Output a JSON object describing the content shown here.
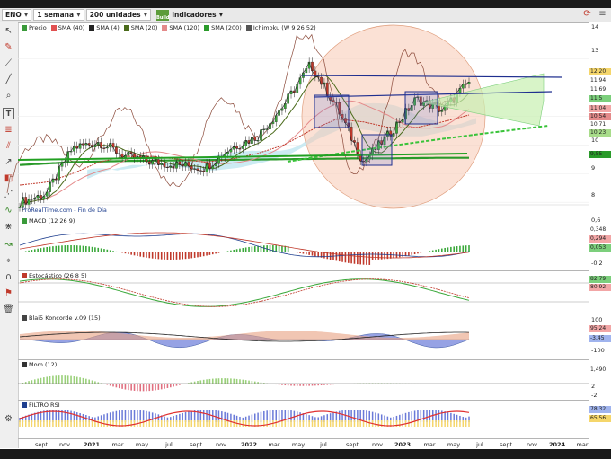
{
  "toolbar": {
    "ticker": "ENO",
    "period": "1 semana",
    "units": "200 unidades",
    "indicators": "Indicadores",
    "ind_icon_text": "Build"
  },
  "main_pane": {
    "legend": [
      {
        "label": "Precio",
        "color": "#3a9a3a"
      },
      {
        "label": "SMA (40)",
        "color": "#e05050"
      },
      {
        "label": "SMA (4)",
        "color": "#222222"
      },
      {
        "label": "SMA (20)",
        "color": "#4a6a1a"
      },
      {
        "label": "SMA (120)",
        "color": "#e48a8a"
      },
      {
        "label": "SMA (200)",
        "color": "#2a9a2a"
      },
      {
        "label": "Ichimoku (W 9 26 52)",
        "color": "#555555"
      }
    ],
    "watermark": "ProRealTime.com - Fin de Dia",
    "scale_ticks": [
      "14",
      "13",
      "11",
      "10",
      "9",
      "8"
    ],
    "value_boxes": [
      {
        "text": "12,20",
        "color": "#f5d66b"
      },
      {
        "text": "11,94",
        "color": "#ffffff"
      },
      {
        "text": "11,69",
        "color": "#ffffff"
      },
      {
        "text": "11,5",
        "color": "#7ccf7c"
      },
      {
        "text": "11,04",
        "color": "#f2a6a6"
      },
      {
        "text": "10,54",
        "color": "#e48a8a"
      },
      {
        "text": "10,71",
        "color": "#ffffff"
      },
      {
        "text": "10,23",
        "color": "#a8dc8a"
      },
      {
        "text": "9,55",
        "color": "#2a9a2a"
      }
    ]
  },
  "macd_pane": {
    "legend": "MACD (12 26 9)",
    "scale_ticks": [
      "0,6",
      "-0,2"
    ],
    "value_boxes": [
      {
        "text": "0,348",
        "color": "#ffffff"
      },
      {
        "text": "0,294",
        "color": "#f2a6a6"
      },
      {
        "text": "0,053",
        "color": "#7ccf7c"
      }
    ]
  },
  "stoch_pane": {
    "legend": "Estocástico (26 8 5)",
    "value_boxes": [
      {
        "text": "82,79",
        "color": "#7ccf7c"
      },
      {
        "text": "80,92",
        "color": "#f2a6a6"
      }
    ]
  },
  "koncorde_pane": {
    "legend": "Blai5 Koncorde v.09 (15)",
    "scale_ticks": [
      "100",
      "-100"
    ],
    "value_boxes": [
      {
        "text": "95,24",
        "color": "#f2a6a6"
      },
      {
        "text": "-3,45",
        "color": "#a0b4ee"
      }
    ]
  },
  "mom_pane": {
    "legend": "Mom (12)",
    "scale_ticks": [
      "2",
      "-2"
    ],
    "value_boxes": [
      {
        "text": "1,490",
        "color": "#ffffff"
      }
    ]
  },
  "rsi_pane": {
    "legend": "FILTRO RSI",
    "value_boxes": [
      {
        "text": "78,32",
        "color": "#a0b4ee"
      },
      {
        "text": "65,56",
        "color": "#f5d66b"
      }
    ]
  },
  "x_axis": {
    "labels": [
      {
        "text": "sept",
        "year": false
      },
      {
        "text": "nov",
        "year": false
      },
      {
        "text": "2021",
        "year": true
      },
      {
        "text": "mar",
        "year": false
      },
      {
        "text": "may",
        "year": false
      },
      {
        "text": "jul",
        "year": false
      },
      {
        "text": "sept",
        "year": false
      },
      {
        "text": "nov",
        "year": false
      },
      {
        "text": "2022",
        "year": true
      },
      {
        "text": "mar",
        "year": false
      },
      {
        "text": "may",
        "year": false
      },
      {
        "text": "jul",
        "year": false
      },
      {
        "text": "sept",
        "year": false
      },
      {
        "text": "nov",
        "year": false
      },
      {
        "text": "2023",
        "year": true
      },
      {
        "text": "mar",
        "year": false
      },
      {
        "text": "may",
        "year": false
      },
      {
        "text": "jul",
        "year": false
      },
      {
        "text": "sept",
        "year": false
      },
      {
        "text": "nov",
        "year": false
      },
      {
        "text": "2024",
        "year": true
      },
      {
        "text": "mar",
        "year": false
      }
    ]
  },
  "chart_data": {
    "type": "line",
    "ticker": "ENO",
    "timeframe": "1 semana",
    "ylim": [
      7.6,
      14.2
    ],
    "x": [
      "2020-08",
      "2020-10",
      "2020-12",
      "2021-02",
      "2021-04",
      "2021-06",
      "2021-08",
      "2021-10",
      "2021-12",
      "2022-02",
      "2022-04",
      "2022-06",
      "2022-08",
      "2022-10",
      "2022-12",
      "2023-02",
      "2023-04",
      "2023-06"
    ],
    "series": [
      {
        "name": "Precio",
        "values": [
          8.0,
          8.3,
          9.9,
          10.1,
          9.6,
          9.4,
          9.3,
          9.2,
          9.9,
          10.3,
          11.4,
          12.8,
          11.3,
          9.4,
          10.4,
          11.6,
          11.2,
          12.2
        ]
      },
      {
        "name": "SMA (40)",
        "values": [
          8.6,
          8.7,
          9.0,
          9.4,
          9.6,
          9.6,
          9.5,
          9.4,
          9.5,
          9.7,
          10.0,
          10.5,
          10.9,
          10.8,
          10.6,
          10.6,
          10.8,
          11.04
        ]
      },
      {
        "name": "SMA (200)",
        "values": [
          9.3,
          9.35,
          9.4,
          9.42,
          9.44,
          9.45,
          9.46,
          9.47,
          9.48,
          9.49,
          9.5,
          9.51,
          9.52,
          9.53,
          9.53,
          9.54,
          9.55,
          9.55
        ]
      }
    ],
    "macd_range": [
      -0.2,
      0.6
    ],
    "mom_range": [
      -2,
      2
    ],
    "koncorde_range": [
      -100,
      100
    ]
  }
}
